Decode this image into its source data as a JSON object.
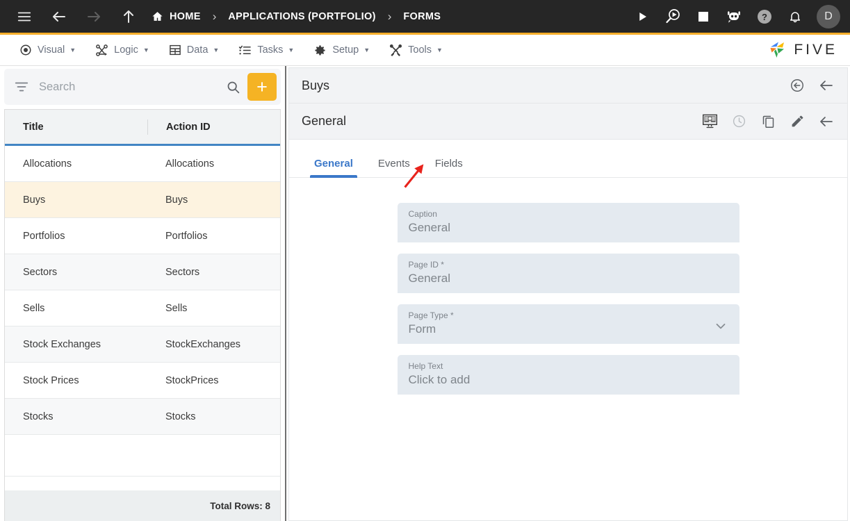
{
  "topbar": {
    "menu_icon": "hamburger-icon",
    "back_icon": "arrow-left-icon",
    "forward_icon": "arrow-right-icon",
    "up_icon": "arrow-up-icon",
    "breadcrumbs": [
      {
        "label": "HOME",
        "icon": "home-icon"
      },
      {
        "label": "APPLICATIONS (PORTFOLIO)",
        "icon": ""
      },
      {
        "label": "FORMS",
        "icon": ""
      }
    ],
    "separator": "›",
    "actions": [
      {
        "name": "run-icon",
        "title": "Run"
      },
      {
        "name": "debug-icon",
        "title": "Debug"
      },
      {
        "name": "stop-icon",
        "title": "Stop"
      },
      {
        "name": "bot-icon",
        "title": "Assistant"
      },
      {
        "name": "help-icon",
        "title": "Help"
      },
      {
        "name": "notifications-icon",
        "title": "Notifications"
      }
    ],
    "avatar_initial": "D"
  },
  "menubar": {
    "items": [
      {
        "label": "Visual",
        "icon": "eye-icon"
      },
      {
        "label": "Logic",
        "icon": "flow-nodes-icon"
      },
      {
        "label": "Data",
        "icon": "table-grid-icon"
      },
      {
        "label": "Tasks",
        "icon": "checklist-icon"
      },
      {
        "label": "Setup",
        "icon": "gear-icon"
      },
      {
        "label": "Tools",
        "icon": "tools-icon"
      }
    ],
    "caret": "▼",
    "brand": "FIVE",
    "accent_color": "#f5ae2a"
  },
  "sidebar": {
    "search": {
      "placeholder": "Search",
      "value": "",
      "filter_icon": "filter-icon",
      "search_icon": "search-icon",
      "add_label": "+"
    },
    "grid": {
      "columns": [
        "Title",
        "Action ID"
      ],
      "rows": [
        {
          "title": "Allocations",
          "action_id": "Allocations"
        },
        {
          "title": "Buys",
          "action_id": "Buys"
        },
        {
          "title": "Portfolios",
          "action_id": "Portfolios"
        },
        {
          "title": "Sectors",
          "action_id": "Sectors"
        },
        {
          "title": "Sells",
          "action_id": "Sells"
        },
        {
          "title": "Stock Exchanges",
          "action_id": "StockExchanges"
        },
        {
          "title": "Stock Prices",
          "action_id": "StockPrices"
        },
        {
          "title": "Stocks",
          "action_id": "Stocks"
        }
      ],
      "selected_index": 1,
      "footer": "Total Rows: 8",
      "header_underline_color": "#4285c4",
      "selected_row_color": "#fdf3e0"
    }
  },
  "detail": {
    "record_bar": {
      "title": "Buys",
      "icons": [
        {
          "name": "revert-circle-icon",
          "title": "Revert"
        },
        {
          "name": "back-arrow-icon",
          "title": "Back"
        }
      ]
    },
    "page_bar": {
      "title": "General",
      "icons": [
        {
          "name": "form-preview-icon",
          "title": "Preview"
        },
        {
          "name": "history-clock-icon",
          "title": "History"
        },
        {
          "name": "duplicate-icon",
          "title": "Duplicate"
        },
        {
          "name": "edit-pencil-icon",
          "title": "Edit"
        },
        {
          "name": "back-arrow-icon",
          "title": "Back"
        }
      ]
    },
    "tabs": [
      {
        "label": "General",
        "active": true
      },
      {
        "label": "Events",
        "active": false
      },
      {
        "label": "Fields",
        "active": false
      }
    ],
    "active_tab_color": "#3b78c9",
    "fields": [
      {
        "label": "Caption",
        "value": "General",
        "type": "text"
      },
      {
        "label": "Page ID *",
        "value": "General",
        "type": "text"
      },
      {
        "label": "Page Type *",
        "value": "Form",
        "type": "select"
      },
      {
        "label": "Help Text",
        "value": "Click to add",
        "type": "text"
      }
    ],
    "annotation": {
      "name": "red-arrow-annotation",
      "color": "#e8231c",
      "points_to": "Fields"
    }
  }
}
